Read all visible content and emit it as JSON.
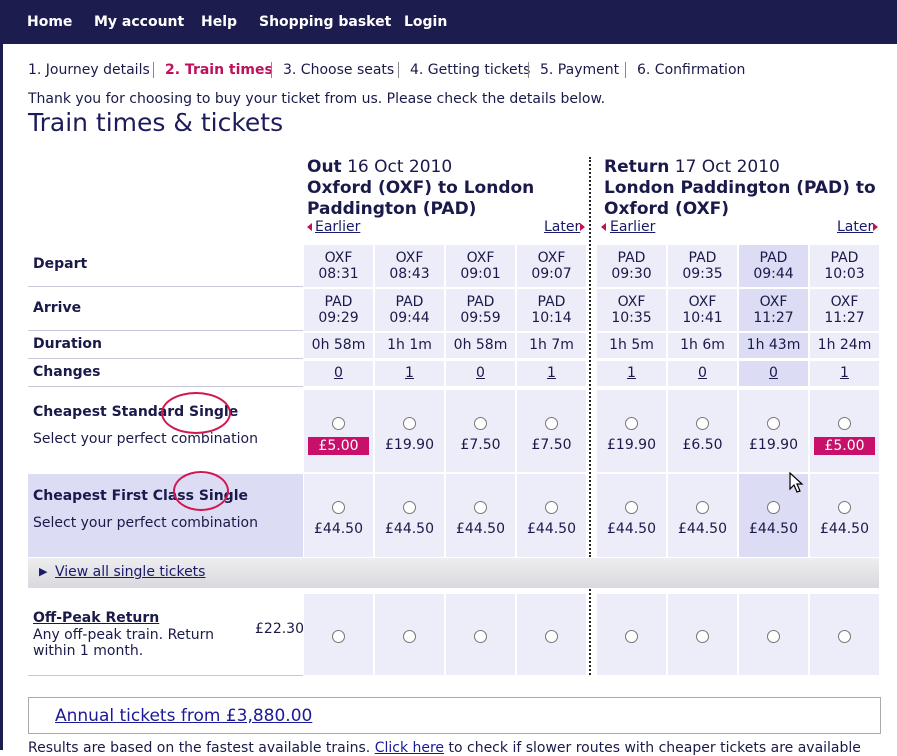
{
  "nav": {
    "home": "Home",
    "account": "My account",
    "help": "Help",
    "basket": "Shopping basket",
    "login": "Login"
  },
  "steps": [
    "1. Journey details",
    "2. Train times",
    "3. Choose seats",
    "4. Getting tickets",
    "5. Payment",
    "6. Confirmation"
  ],
  "intro": "Thank you for choosing to buy your ticket from us. Please check the details below.",
  "page_title": "Train times & tickets",
  "out": {
    "label": "Out",
    "date": "16 Oct 2010",
    "route1": "Oxford (OXF) to London",
    "route2": "Paddington (PAD)",
    "earlier": "Earlier",
    "later": "Later"
  },
  "ret": {
    "label": "Return",
    "date": "17 Oct 2010",
    "route1": "London Paddington (PAD) to",
    "route2": "Oxford (OXF)",
    "earlier": "Earlier",
    "later": "Later"
  },
  "row_labels": {
    "depart": "Depart",
    "arrive": "Arrive",
    "duration": "Duration",
    "changes": "Changes",
    "std": "Cheapest Standard Single",
    "first": "Cheapest First Class Single",
    "sub": "Select your perfect combination"
  },
  "trains": [
    {
      "dep_st": "OXF",
      "dep": "08:31",
      "arr_st": "PAD",
      "arr": "09:29",
      "dur": "0h 58m",
      "chg": "0",
      "std": "£5.00",
      "first": "£44.50"
    },
    {
      "dep_st": "OXF",
      "dep": "08:43",
      "arr_st": "PAD",
      "arr": "09:44",
      "dur": "1h 1m",
      "chg": "1",
      "std": "£19.90",
      "first": "£44.50"
    },
    {
      "dep_st": "OXF",
      "dep": "09:01",
      "arr_st": "PAD",
      "arr": "09:59",
      "dur": "0h 58m",
      "chg": "0",
      "std": "£7.50",
      "first": "£44.50"
    },
    {
      "dep_st": "OXF",
      "dep": "09:07",
      "arr_st": "PAD",
      "arr": "10:14",
      "dur": "1h 7m",
      "chg": "1",
      "std": "£7.50",
      "first": "£44.50"
    },
    {
      "dep_st": "PAD",
      "dep": "09:30",
      "arr_st": "OXF",
      "arr": "10:35",
      "dur": "1h 5m",
      "chg": "1",
      "std": "£19.90",
      "first": "£44.50"
    },
    {
      "dep_st": "PAD",
      "dep": "09:35",
      "arr_st": "OXF",
      "arr": "10:41",
      "dur": "1h 6m",
      "chg": "0",
      "std": "£6.50",
      "first": "£44.50"
    },
    {
      "dep_st": "PAD",
      "dep": "09:44",
      "arr_st": "OXF",
      "arr": "11:27",
      "dur": "1h 43m",
      "chg": "0",
      "std": "£19.90",
      "first": "£44.50"
    },
    {
      "dep_st": "PAD",
      "dep": "10:03",
      "arr_st": "OXF",
      "arr": "11:27",
      "dur": "1h 24m",
      "chg": "1",
      "std": "£5.00",
      "first": "£44.50"
    }
  ],
  "view_all": "View all single tickets",
  "offpeak": {
    "title": "Off-Peak Return",
    "desc1": "Any off-peak train. Return",
    "desc2": "within 1 month.",
    "price": "£22.30"
  },
  "annual": "Annual tickets from £3,880.00",
  "bottom": {
    "pre": "Results are based on the fastest available trains. ",
    "link": "Click here",
    "post": " to check if slower routes with cheaper tickets are available"
  },
  "colors": {
    "nav_bg": "#1c1c4e",
    "accent": "#c0105a",
    "cell_bg": "#ededf9",
    "cell_highlight": "#dcdcf5"
  }
}
